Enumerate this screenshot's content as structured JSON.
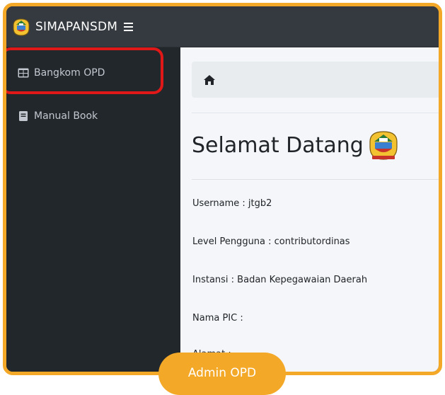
{
  "app": {
    "brand": "SIMAPANSDM"
  },
  "sidebar": {
    "items": [
      {
        "label": "Bangkom OPD",
        "icon": "table-icon"
      },
      {
        "label": "Manual Book",
        "icon": "book-icon"
      }
    ]
  },
  "breadcrumb": {
    "icon": "home-icon"
  },
  "main": {
    "title": "Selamat Datang",
    "username": "Username : jtgb2",
    "level": "Level Pengguna : contributordinas",
    "instansi": "Instansi : Badan Kepegawaian Daerah",
    "pic": "Nama PIC :",
    "alamat": "Alamat :"
  },
  "overlay": {
    "badge": "Admin OPD"
  },
  "colors": {
    "frame": "#f4a828",
    "topbar": "#343a40",
    "sidebar": "#22272b",
    "highlight": "#e01818",
    "content": "#f4f6f9"
  }
}
